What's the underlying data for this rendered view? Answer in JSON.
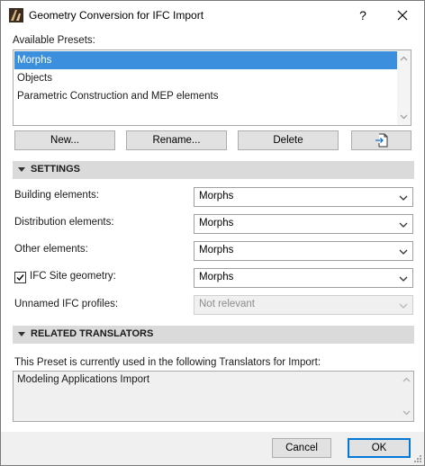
{
  "window": {
    "title": "Geometry Conversion for IFC Import",
    "help_label": "?"
  },
  "presets": {
    "label": "Available Presets:",
    "items": [
      {
        "label": "Morphs",
        "selected": true
      },
      {
        "label": "Objects",
        "selected": false
      },
      {
        "label": "Parametric Construction and MEP elements",
        "selected": false
      }
    ],
    "buttons": {
      "new": "New...",
      "rename": "Rename...",
      "delete": "Delete",
      "import_icon": "import-file-icon"
    }
  },
  "settings": {
    "title": "SETTINGS",
    "rows": [
      {
        "label": "Building elements:",
        "value": "Morphs",
        "enabled": true
      },
      {
        "label": "Distribution elements:",
        "value": "Morphs",
        "enabled": true
      },
      {
        "label": "Other elements:",
        "value": "Morphs",
        "enabled": true
      },
      {
        "label": "IFC Site geometry:",
        "value": "Morphs",
        "enabled": true,
        "checked": true
      },
      {
        "label": "Unnamed IFC profiles:",
        "value": "Not relevant",
        "enabled": false
      }
    ]
  },
  "related": {
    "title": "RELATED TRANSLATORS",
    "description": "This Preset is currently used in the following Translators for Import:",
    "items": [
      "Modeling Applications Import"
    ]
  },
  "footer": {
    "cancel": "Cancel",
    "ok": "OK"
  },
  "colors": {
    "selection": "#3b8fdc",
    "section_bar": "#dadada",
    "button_face": "#e1e1e1",
    "default_button_border": "#0078d7"
  }
}
